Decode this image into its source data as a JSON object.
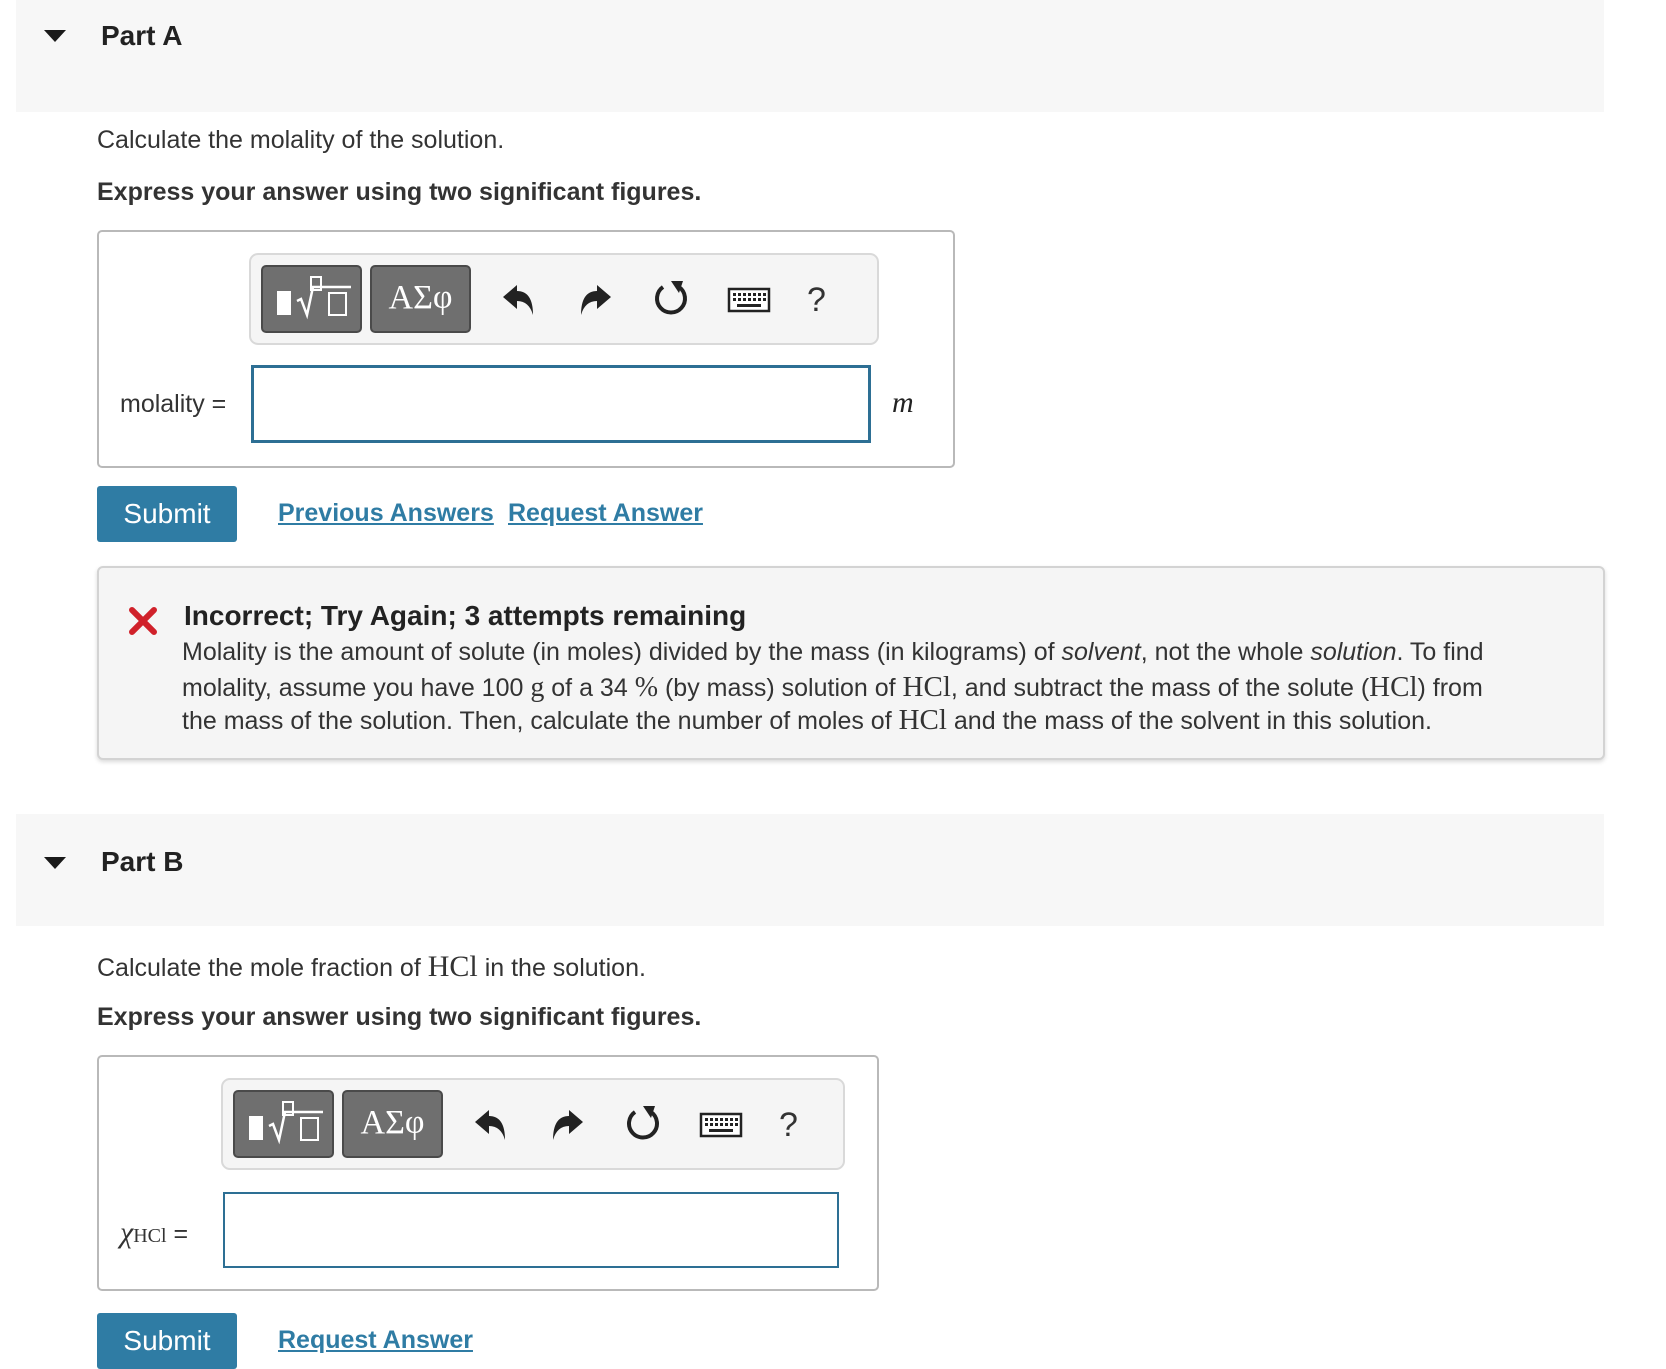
{
  "part_a": {
    "title": "Part A",
    "question": "Calculate the molality of the solution.",
    "instruction": "Express your answer using two significant figures.",
    "toolbar": {
      "greek_label": "ΑΣφ",
      "help_label": "?"
    },
    "field_label": "molality =",
    "field_value": "",
    "unit": "m",
    "submit_label": "Submit",
    "links": [
      "Previous Answers",
      "Request Answer"
    ],
    "feedback": {
      "title": "Incorrect; Try Again; 3 attempts remaining",
      "line1": {
        "a": "Molality is the amount of solute (in moles) divided by the mass (in kilograms) of ",
        "b": "solvent",
        "c": ", not the whole ",
        "d": "solution",
        "e": ". To find"
      },
      "line2": {
        "a": "molality, assume you have 100 ",
        "b": "g",
        "c": " of a 34 ",
        "d": "%",
        "e": " (by mass) solution of ",
        "f": "HCl",
        "g": ", and subtract the mass of the solute (",
        "h": "HCl",
        "i": ") from"
      },
      "line3": {
        "a": "the mass of the solution. Then, calculate the number of moles of ",
        "b": "HCl",
        "c": " and the mass of the solvent in this solution."
      }
    }
  },
  "part_b": {
    "title": "Part B",
    "question": {
      "a": "Calculate the mole fraction of ",
      "b": "HCl",
      "c": " in the solution."
    },
    "instruction": "Express your answer using two significant figures.",
    "toolbar": {
      "greek_label": "ΑΣφ",
      "help_label": "?"
    },
    "field_label": {
      "chi": "χ",
      "sub": "HCl",
      "eq": "="
    },
    "field_value": "",
    "submit_label": "Submit",
    "links": [
      "Request Answer"
    ]
  },
  "colors": {
    "accent": "#2f7ca4",
    "error": "#d0212a",
    "header_bg": "#f7f7f7"
  }
}
